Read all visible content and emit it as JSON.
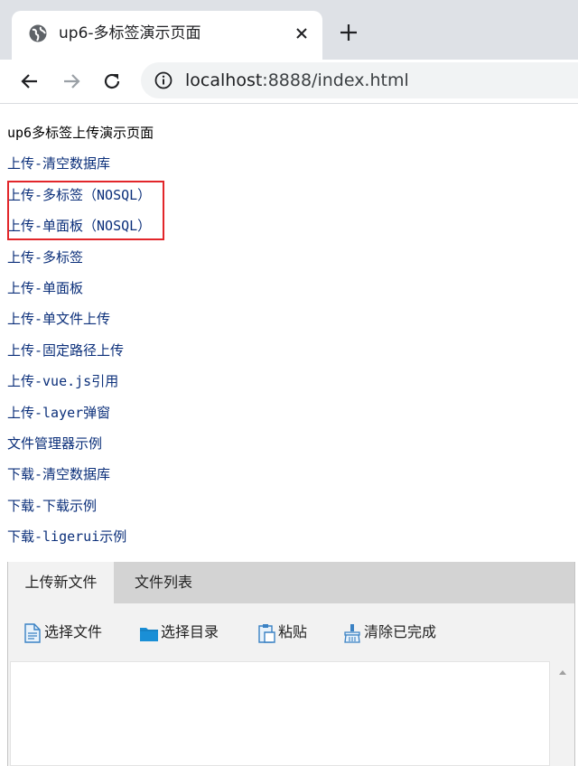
{
  "browser": {
    "tab_title": "up6-多标签演示页面",
    "url_host": "localhost",
    "url_rest": ":8888/index.html",
    "icons": {
      "favicon": "globe-icon",
      "close": "close-icon",
      "new_tab": "plus-icon",
      "back": "back-arrow-icon",
      "forward": "forward-arrow-icon",
      "reload": "reload-icon",
      "site_info": "info-icon"
    }
  },
  "page": {
    "heading": "up6多标签上传演示页面",
    "links": [
      "上传-清空数据库",
      "上传-多标签（NOSQL）",
      "上传-单面板（NOSQL）",
      "上传-多标签",
      "上传-单面板",
      "上传-单文件上传",
      "上传-固定路径上传",
      "上传-vue.js引用",
      "上传-layer弹窗",
      "文件管理器示例",
      "下载-清空数据库",
      "下载-下载示例",
      "下载-ligerui示例"
    ],
    "highlight_color": "#e2262a",
    "link_color": "#0b2f7a"
  },
  "uploader": {
    "tabs": [
      "上传新文件",
      "文件列表"
    ],
    "active_tab": "上传新文件",
    "actions": [
      {
        "label": "选择文件",
        "icon": "file-icon"
      },
      {
        "label": "选择目录",
        "icon": "folder-icon"
      },
      {
        "label": "粘贴",
        "icon": "paste-icon"
      },
      {
        "label": "清除已完成",
        "icon": "clear-icon"
      }
    ]
  }
}
